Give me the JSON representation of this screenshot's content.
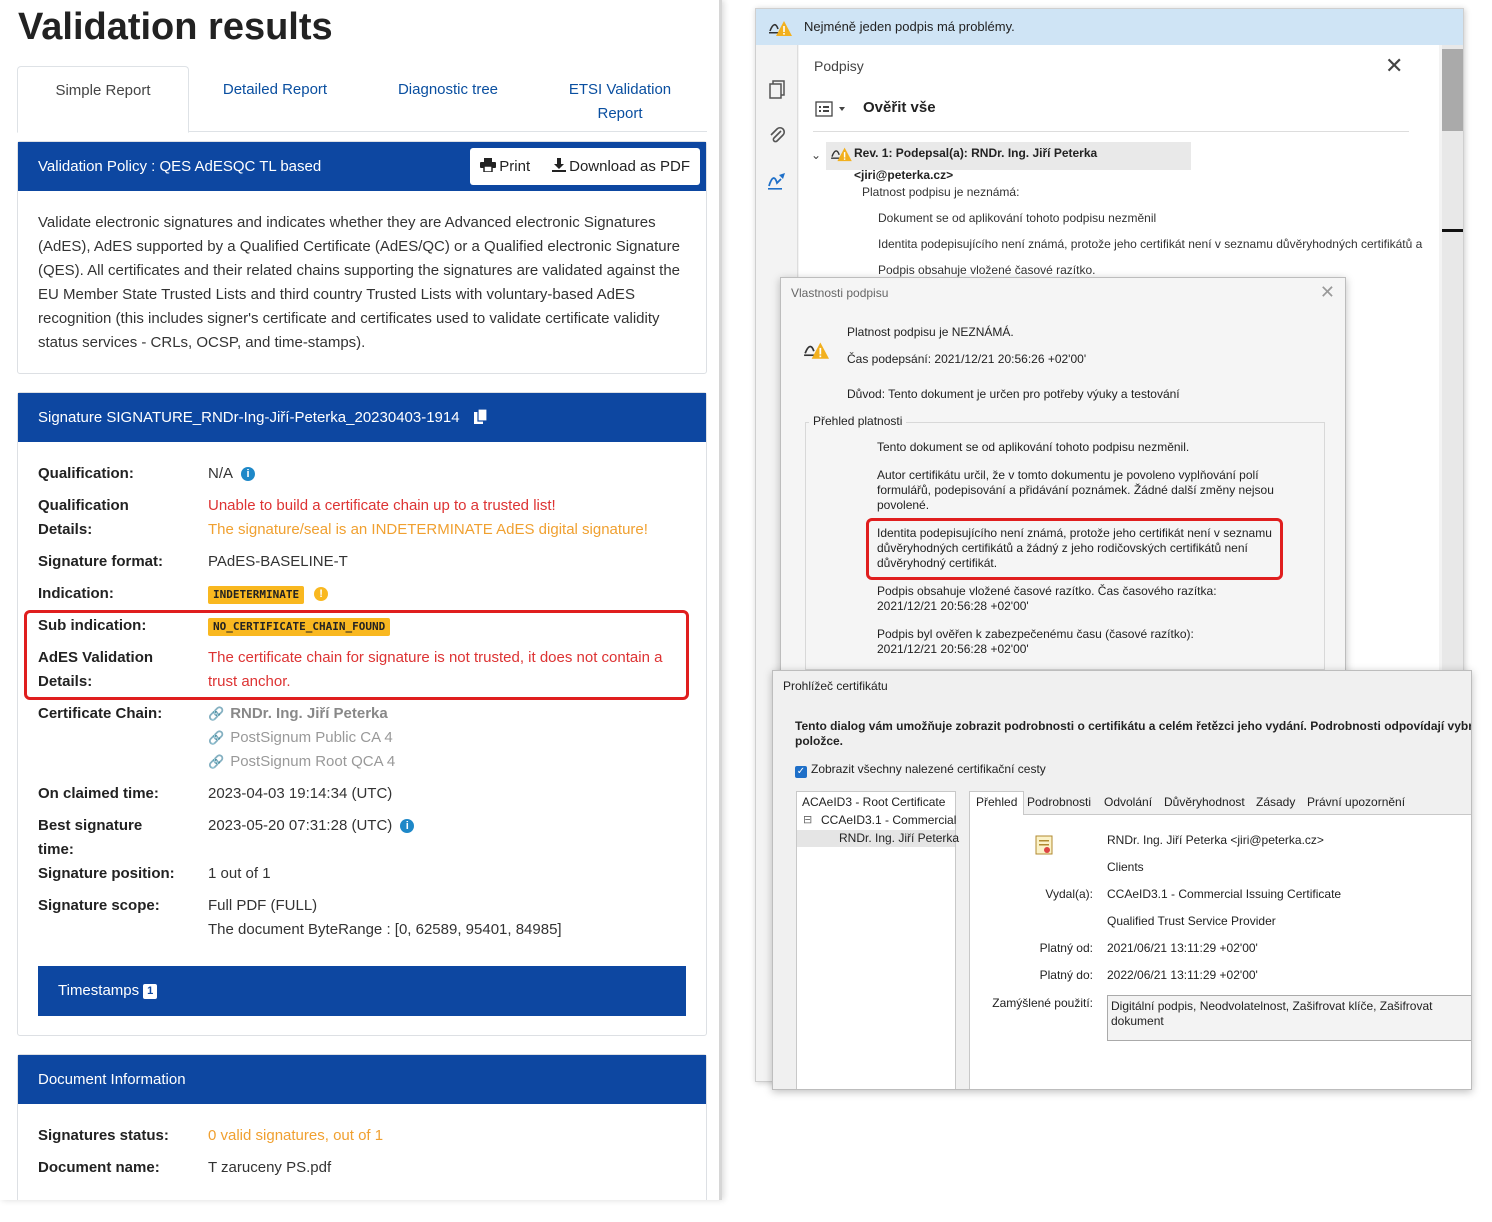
{
  "left": {
    "title": "Validation results",
    "tabs": [
      {
        "label": "Simple Report"
      },
      {
        "label": "Detailed Report"
      },
      {
        "label": "Diagnostic tree"
      },
      {
        "label": "ETSI Validation Report"
      }
    ],
    "policy": {
      "header": "Validation Policy : QES AdESQC TL based",
      "print_label": "Print",
      "download_label": "Download as PDF",
      "description": "Validate electronic signatures and indicates whether they are Advanced electronic Signatures (AdES), AdES supported by a Qualified Certificate (AdES/QC) or a Qualified electronic Signature (QES). All certificates and their related chains supporting the signatures are validated against the EU Member State Trusted Lists and third country Trusted Lists with voluntary-based AdES recognition (this includes signer's certificate and certificates used to validate certificate validity status services - CRLs, OCSP, and time-stamps)."
    },
    "signature": {
      "header": "Signature SIGNATURE_RNDr-Ing-Jiří-Peterka_20230403-1914",
      "qualification_label": "Qualification:",
      "qualification_value": "N/A",
      "qual_details_label_1": "Qualification",
      "qual_details_label_2": "Details:",
      "qual_details_error": "Unable to build a certificate chain up to a trusted list!",
      "qual_details_warning": "The signature/seal is an INDETERMINATE AdES digital signature!",
      "format_label": "Signature format:",
      "format_value": "PAdES-BASELINE-T",
      "indication_label": "Indication:",
      "indication_value": "INDETERMINATE",
      "subindication_label": "Sub indication:",
      "subindication_value": "NO_CERTIFICATE_CHAIN_FOUND",
      "ades_label_1": "AdES Validation",
      "ades_label_2": "Details:",
      "ades_value_1": "The certificate chain for signature is not trusted, it does not contain a",
      "ades_value_2": "trust anchor.",
      "chain_label": "Certificate Chain:",
      "chain": [
        "RNDr. Ing. Jiří Peterka",
        "PostSignum Public CA 4",
        "PostSignum Root QCA 4"
      ],
      "claimed_label": "On claimed time:",
      "claimed_value": "2023-04-03 19:14:34 (UTC)",
      "best_label_1": "Best signature",
      "best_label_2": "time:",
      "best_value": "2023-05-20 07:31:28 (UTC)",
      "position_label": "Signature position:",
      "position_value": "1 out of 1",
      "scope_label": "Signature scope:",
      "scope_value_1": "Full PDF (FULL)",
      "scope_value_2": "The document ByteRange : [0, 62589, 95401, 84985]",
      "timestamps_label": "Timestamps",
      "timestamps_count": "1"
    },
    "document": {
      "header": "Document Information",
      "status_label": "Signatures status:",
      "status_value": "0 valid signatures, out of 1",
      "name_label": "Document name:",
      "name_value": "T zaruceny PS.pdf"
    }
  },
  "acrobat": {
    "notice": "Nejméně jeden podpis má problémy.",
    "panel_title": "Podpisy",
    "verify_all": "Ověřit vše",
    "rev": "Rev. 1: Podepsal(a): RNDr. Ing. Jiří Peterka <jiri@peterka.cz>",
    "validity_unknown": "Platnost podpisu je neznámá:",
    "item1": "Dokument se od aplikování tohoto podpisu nezměnil",
    "item2": "Identita podepisujícího není známá, protože jeho certifikát není v seznamu důvěryhodných certifikátů a",
    "item3": "Podpis obsahuje vložené časové razítko."
  },
  "props_dialog": {
    "title": "Vlastnosti podpisu",
    "validity": "Platnost podpisu je NEZNÁMÁ.",
    "signing_time": "Čas podepsání:  2021/12/21 20:56:26 +02'00'",
    "reason": "Důvod:  Tento dokument je určen pro potřeby výuky a testování",
    "group_label": "Přehled platnosti",
    "p1": "Tento dokument se od aplikování tohoto podpisu nezměnil.",
    "p2_1": "Autor certifikátu určil, že v tomto dokumentu je povoleno vyplňování polí",
    "p2_2": "formulářů, podepisování a přidávání poznámek. Žádné další změny nejsou",
    "p2_3": "povolené.",
    "p3_1": "Identita podepisujícího není známá, protože jeho certifikát není v seznamu",
    "p3_2": "důvěryhodných certifikátů a žádný z jeho rodičovských certifikátů není",
    "p3_3": "důvěryhodný certifikát.",
    "p4_1": "Podpis obsahuje vložené časové razítko. Čas časového razítka:",
    "p4_2": "2021/12/21 20:56:28 +02'00'",
    "p5_1": "Podpis byl ověřen k zabezpečenému času (časové razítko):",
    "p5_2": "2021/12/21 20:56:28 +02'00'"
  },
  "cert_dialog": {
    "title": "Prohlížeč certifikátu",
    "intro_1": "Tento dialog vám umožňuje zobrazit podrobnosti o certifikátu a celém řetězci jeho vydání. Podrobnosti odpovídají vybrané",
    "intro_2": "položce.",
    "show_all": "Zobrazit všechny nalezené certifikační cesty",
    "tree": [
      "ACAeID3 - Root Certificate",
      "CCAeID3.1 - Commercial",
      "RNDr. Ing. Jiří Peterka"
    ],
    "tabs": [
      "Přehled",
      "Podrobnosti",
      "Odvolání",
      "Důvěryhodnost",
      "Zásady",
      "Právní upozornění"
    ],
    "subject": "RNDr. Ing. Jiří Peterka <jiri@peterka.cz>",
    "subject_org": "Clients",
    "issuer_label": "Vydal(a):",
    "issuer": "CCAeID3.1 - Commercial Issuing Certificate",
    "issuer_org": "Qualified Trust Service Provider",
    "valid_from_label": "Platný od:",
    "valid_from": "2021/06/21 13:11:29 +02'00'",
    "valid_to_label": "Platný do:",
    "valid_to": "2022/06/21 13:11:29 +02'00'",
    "usage_label": "Zamýšlené použití:",
    "usage_1": "Digitální podpis, Neodvolatelnost, Zašifrovat klíče, Zašifrovat",
    "usage_2": "dokument"
  },
  "colors": {
    "primary": "#0d47a1",
    "error": "#dd3333",
    "warning": "#f0a030",
    "badge": "#f9b820",
    "highlight": "#e01e1e"
  }
}
